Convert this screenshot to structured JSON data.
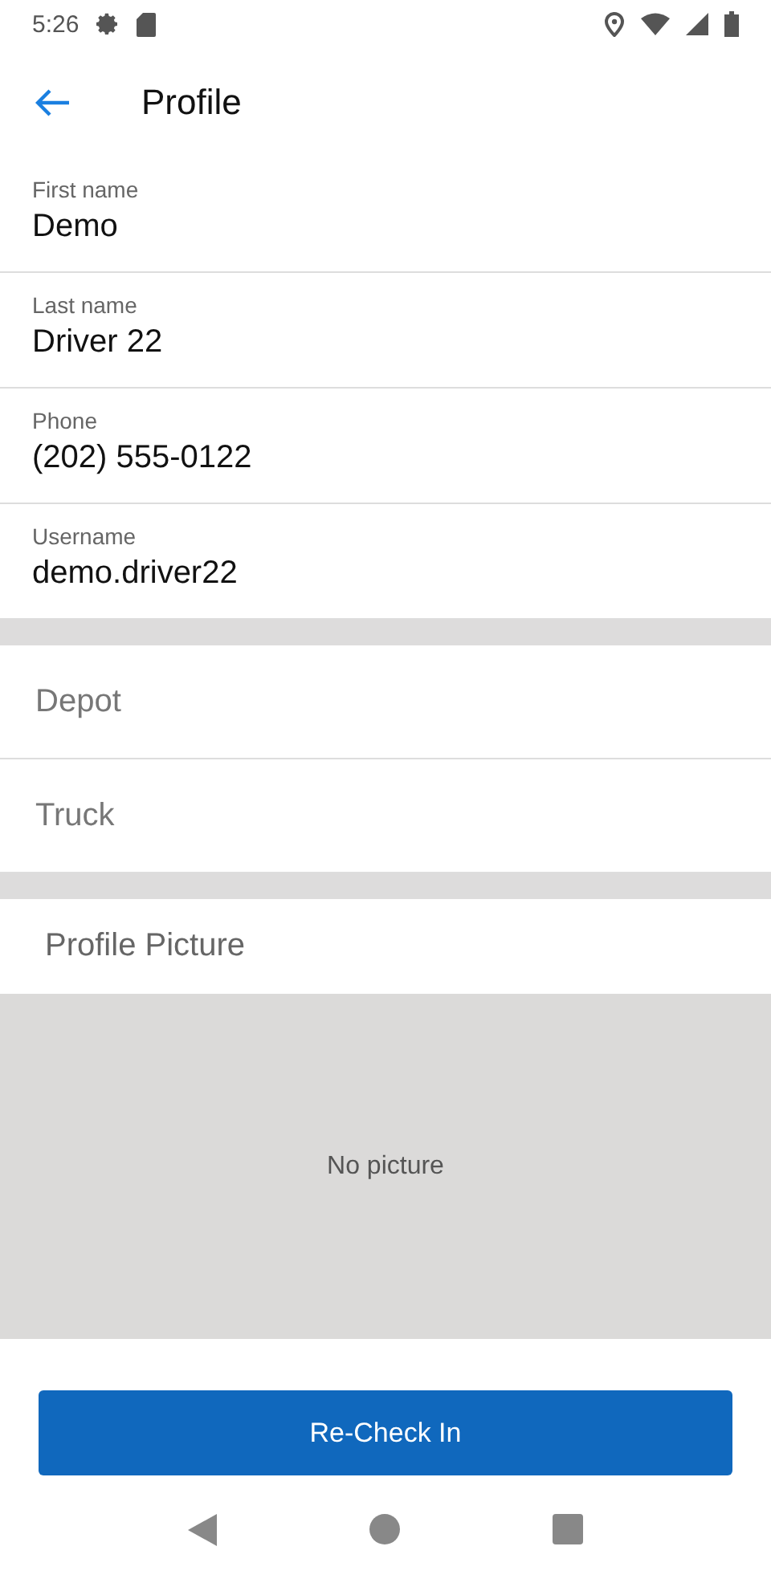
{
  "status_bar": {
    "time": "5:26"
  },
  "header": {
    "title": "Profile"
  },
  "fields": [
    {
      "label": "First name",
      "value": "Demo"
    },
    {
      "label": "Last name",
      "value": "Driver 22"
    },
    {
      "label": "Phone",
      "value": "(202) 555-0122"
    },
    {
      "label": "Username",
      "value": "demo.driver22"
    }
  ],
  "selects": [
    {
      "placeholder": "Depot"
    },
    {
      "placeholder": "Truck"
    }
  ],
  "profile_picture": {
    "title": "Profile Picture",
    "empty_text": "No picture"
  },
  "button": "Re-Check In"
}
